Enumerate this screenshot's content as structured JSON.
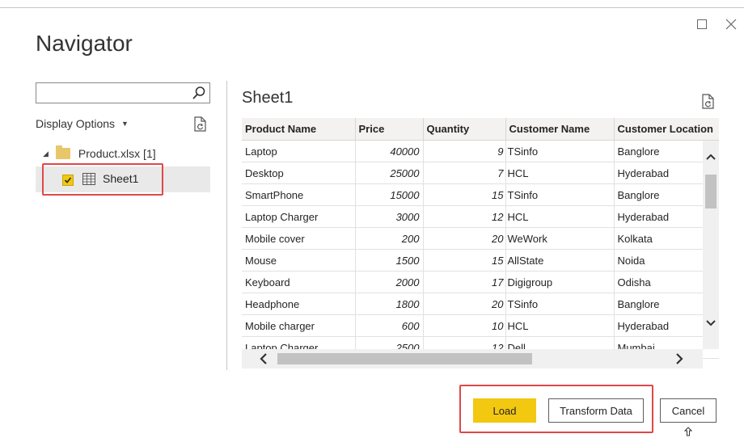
{
  "dialog": {
    "title": "Navigator"
  },
  "search": {
    "value": "",
    "placeholder": ""
  },
  "display_options": {
    "label": "Display Options"
  },
  "tree": {
    "root_label": "Product.xlsx [1]",
    "items": [
      {
        "label": "Sheet1",
        "checked": true,
        "selected": true
      }
    ]
  },
  "preview": {
    "title": "Sheet1",
    "columns": [
      "Product Name",
      "Price",
      "Quantity",
      "Customer Name",
      "Customer Location"
    ],
    "rows": [
      [
        "Laptop",
        "40000",
        "9",
        "TSinfo",
        "Banglore"
      ],
      [
        "Desktop",
        "25000",
        "7",
        "HCL",
        "Hyderabad"
      ],
      [
        "SmartPhone",
        "15000",
        "15",
        "TSinfo",
        "Banglore"
      ],
      [
        "Laptop Charger",
        "3000",
        "12",
        "HCL",
        "Hyderabad"
      ],
      [
        "Mobile cover",
        "200",
        "20",
        "WeWork",
        "Kolkata"
      ],
      [
        "Mouse",
        "1500",
        "15",
        "AllState",
        "Noida"
      ],
      [
        "Keyboard",
        "2000",
        "17",
        "Digigroup",
        "Odisha"
      ],
      [
        "Headphone",
        "1800",
        "20",
        "TSinfo",
        "Banglore"
      ],
      [
        "Mobile charger",
        "600",
        "10",
        "HCL",
        "Hyderabad"
      ],
      [
        "Laptop Charger",
        "2500",
        "12",
        "Dell",
        "Mumbai"
      ]
    ]
  },
  "buttons": {
    "load": "Load",
    "transform": "Transform Data",
    "cancel": "Cancel"
  },
  "colors": {
    "accent": "#f2c811",
    "highlight": "#e04848"
  }
}
